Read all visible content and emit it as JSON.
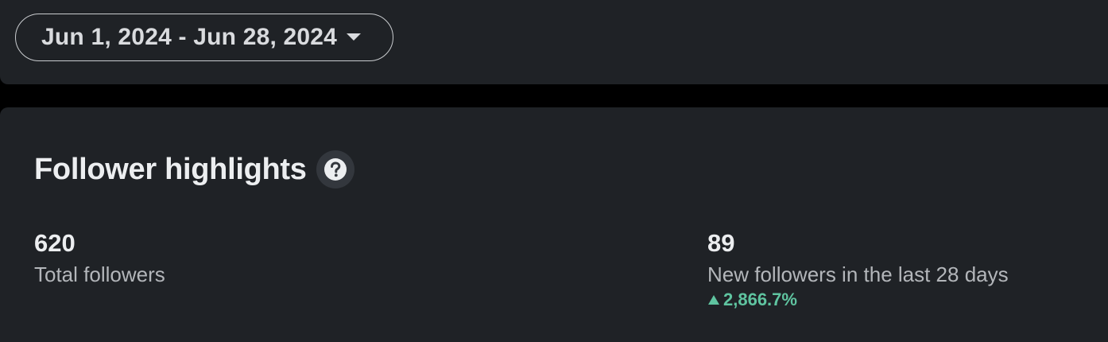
{
  "date_range": {
    "label": "Jun 1, 2024 - Jun 28, 2024",
    "icon": "chevron-down-icon"
  },
  "follower_highlights": {
    "title": "Follower highlights",
    "help_icon": "question-icon",
    "total_followers": {
      "value": "620",
      "label": "Total followers"
    },
    "new_followers": {
      "value": "89",
      "label": "New followers in the last 28 days",
      "change": "2,866.7%",
      "change_direction": "up",
      "change_color": "#5fc4a0"
    }
  }
}
